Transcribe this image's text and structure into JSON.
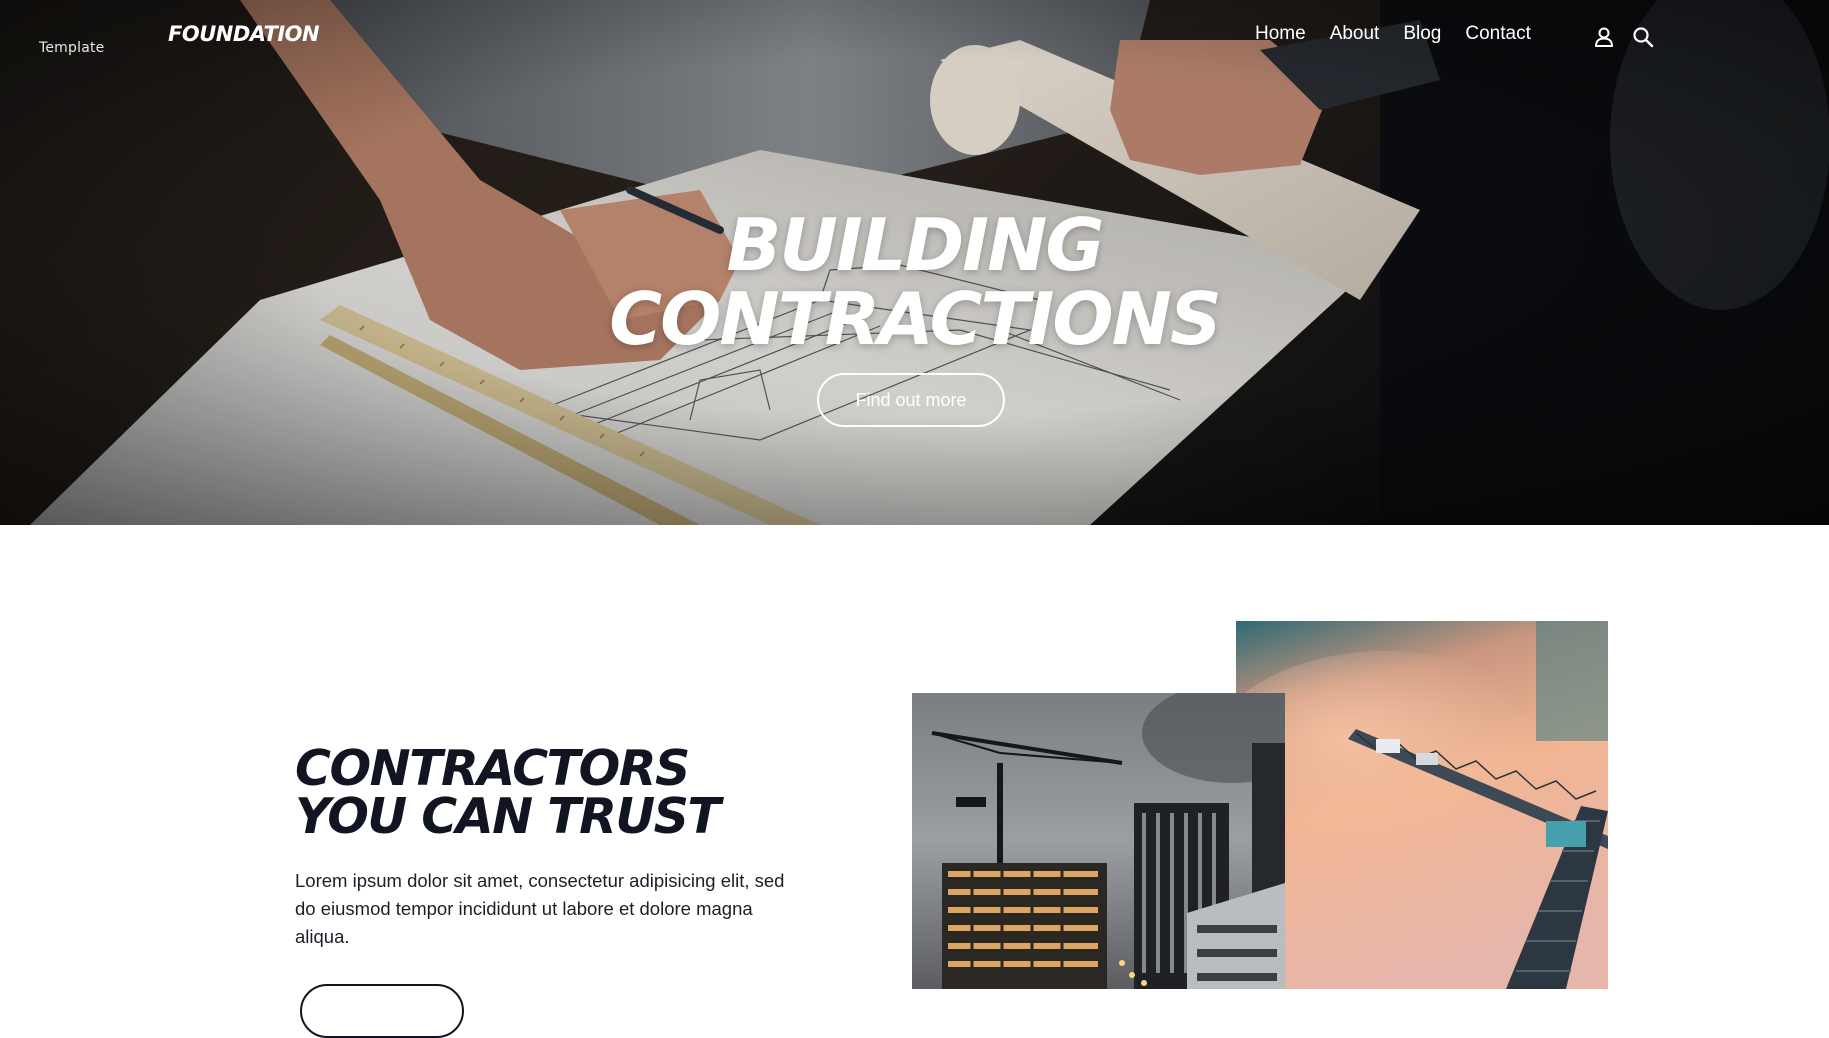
{
  "nav": {
    "template_label": "Template",
    "logo": "FOUNDATION",
    "links": [
      "Home",
      "About",
      "Blog",
      "Contact"
    ],
    "icons": [
      "user-icon",
      "search-icon"
    ]
  },
  "hero": {
    "title_line1": "BUILDING",
    "title_line2": "CONTRACTIONS",
    "cta_label": "Find out more"
  },
  "intro": {
    "title_line1": "CONTRACTORS",
    "title_line2": "YOU CAN TRUST",
    "text": "Lorem ipsum dolor sit amet, consectetur adipisicing elit, sed do eiusmod tempor incididunt ut labore et dolore magna aliqua."
  },
  "colors": {
    "heading": "#111522",
    "hero_text": "#ffffff"
  }
}
